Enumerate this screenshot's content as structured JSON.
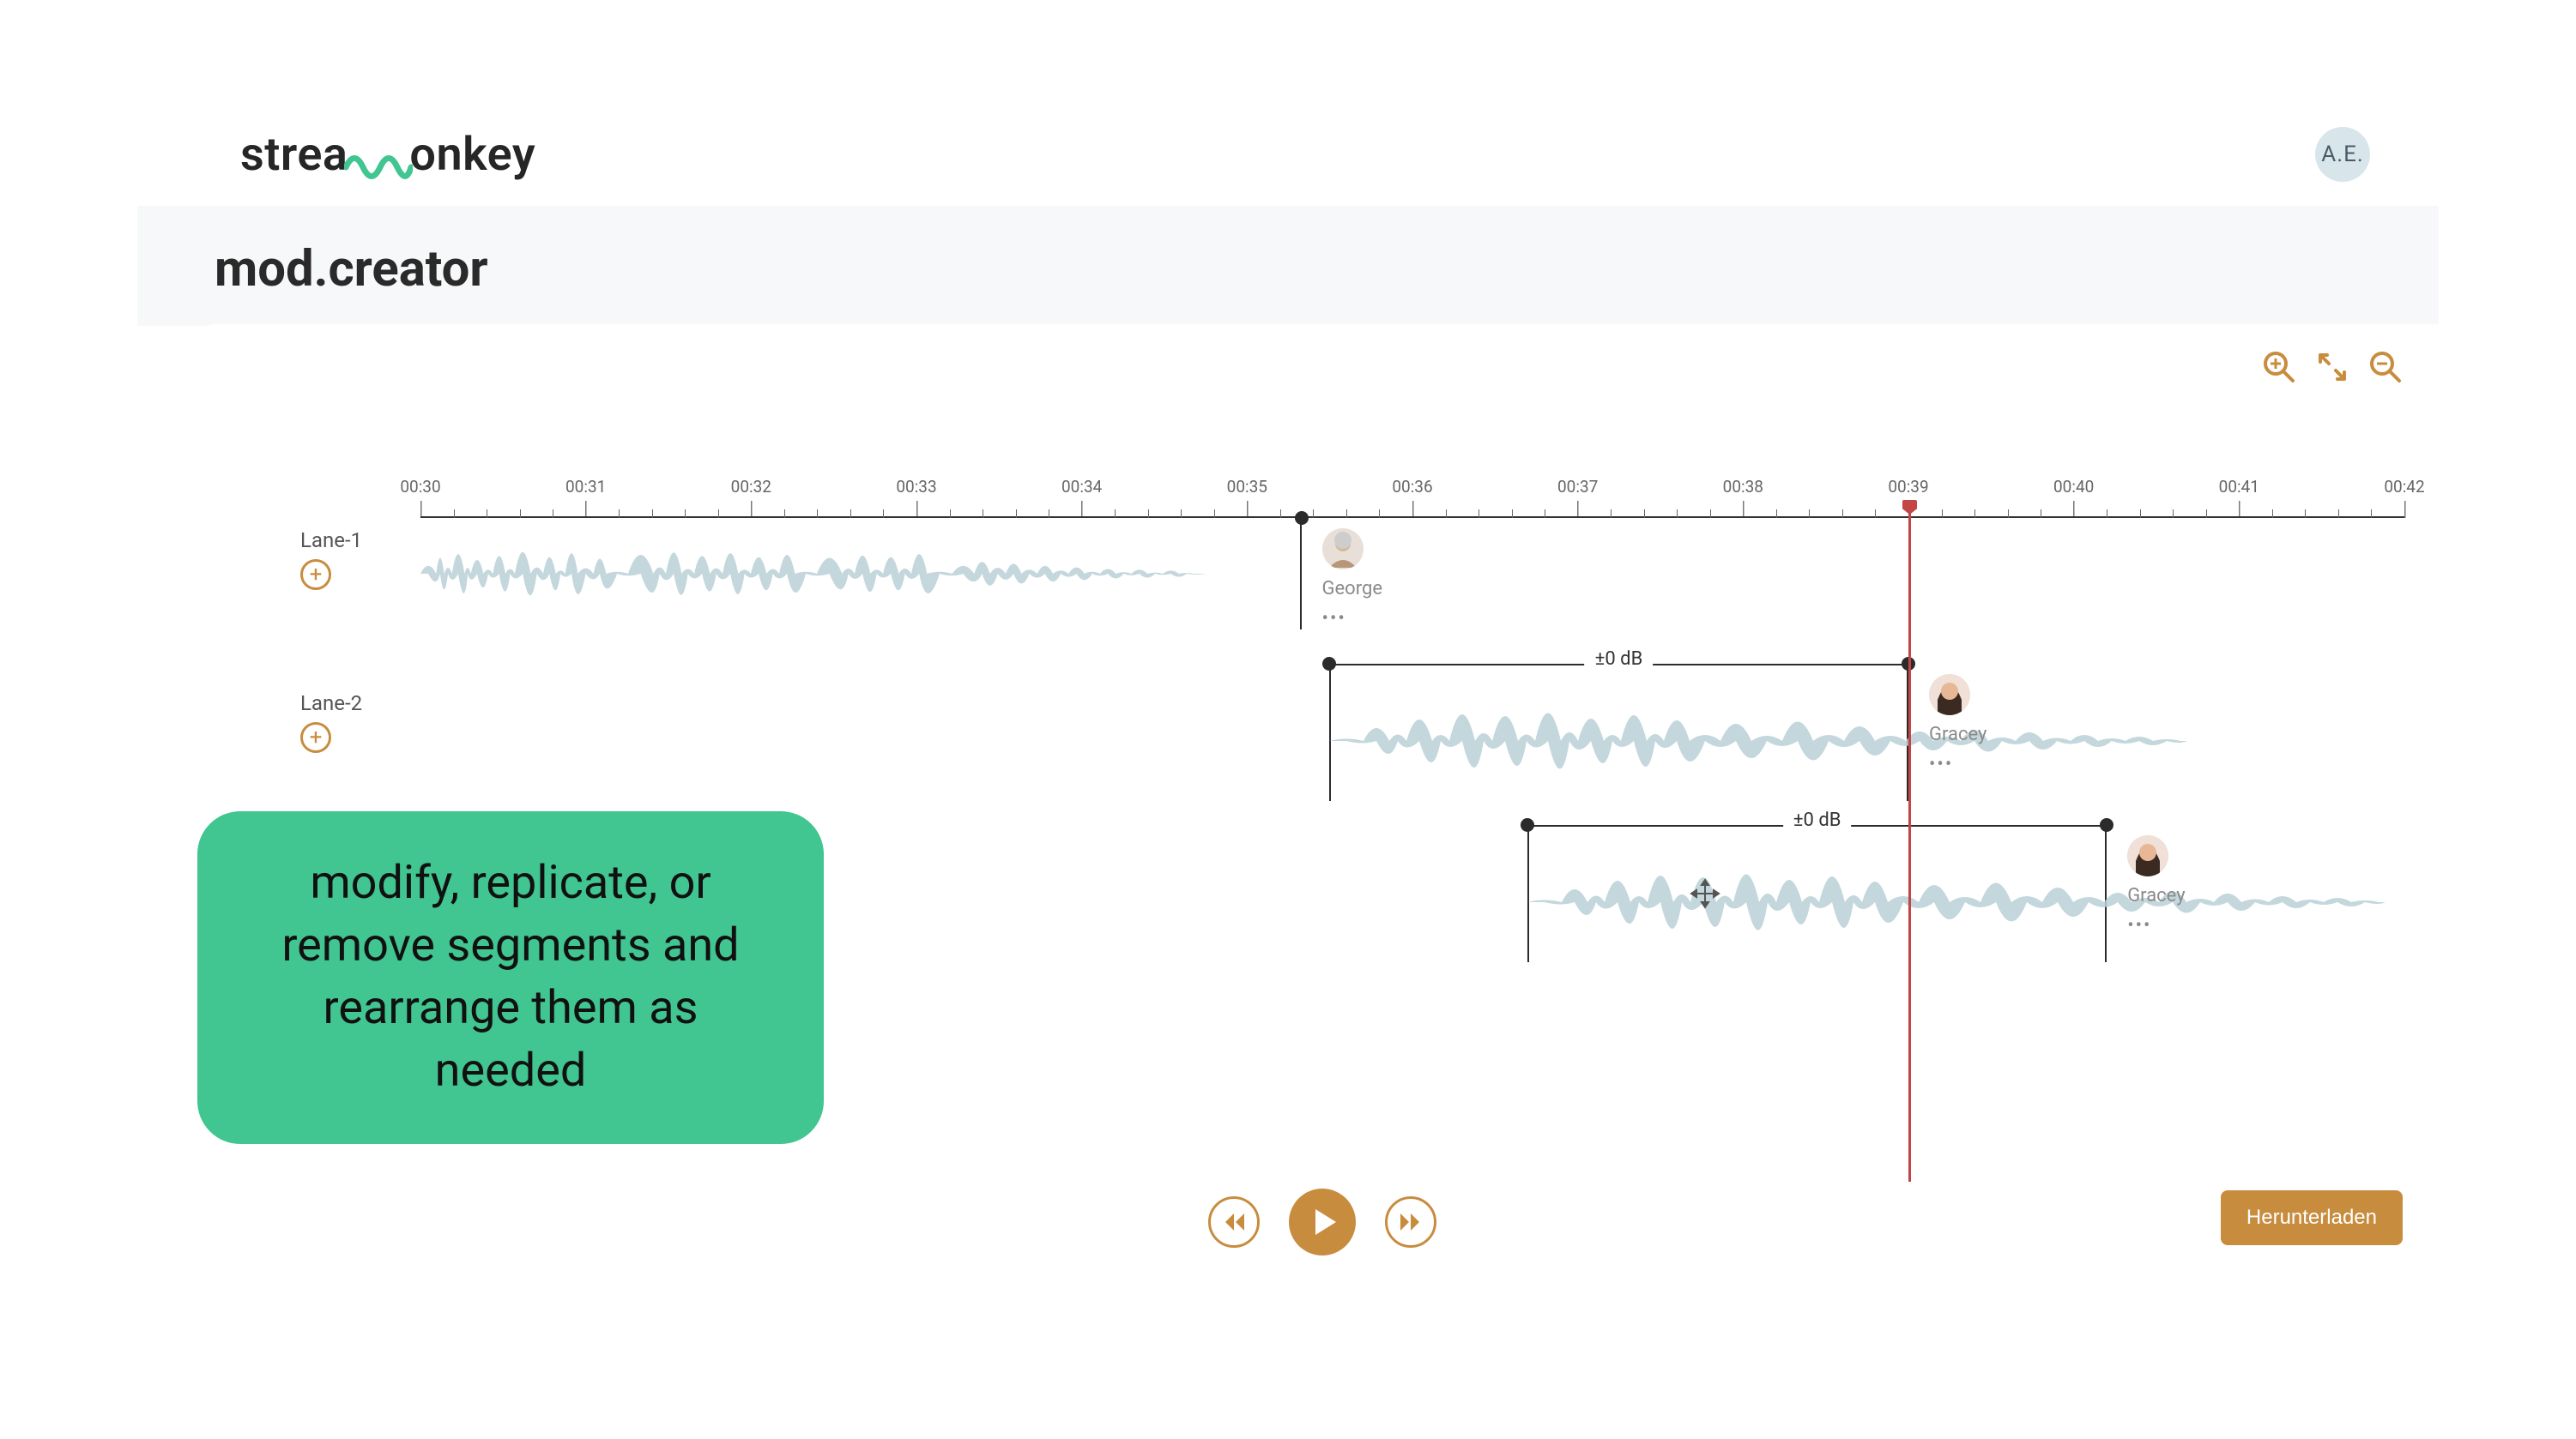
{
  "brand": {
    "prefix": "strea",
    "suffix": "onkey"
  },
  "user": {
    "initials": "A.E."
  },
  "page": {
    "title": "mod.creator"
  },
  "zoom": {
    "in": "zoom in",
    "reset": "fit",
    "out": "zoom out"
  },
  "ruler_ticks": [
    "00:30",
    "00:31",
    "00:32",
    "00:33",
    "00:34",
    "00:35",
    "00:36",
    "00:37",
    "00:38",
    "00:39",
    "00:40",
    "00:41",
    "00:42"
  ],
  "lanes": [
    {
      "id": "lane1",
      "label": "Lane-1"
    },
    {
      "id": "lane2",
      "label": "Lane-2"
    }
  ],
  "clips": [
    {
      "id": "c1",
      "db": "",
      "speaker": "George",
      "face": "man"
    },
    {
      "id": "c2",
      "db": "±0 dB",
      "speaker": "Gracey",
      "face": "woman"
    },
    {
      "id": "c3",
      "db": "±0 dB",
      "speaker": "Gracey",
      "face": "woman"
    }
  ],
  "playhead_pct": 75.0,
  "transport": {
    "rewind": "rewind",
    "play": "play",
    "forward": "forward"
  },
  "download_label": "Herunterladen",
  "callout_text": "modify, replicate, or remove segments and rearrange them as needed"
}
